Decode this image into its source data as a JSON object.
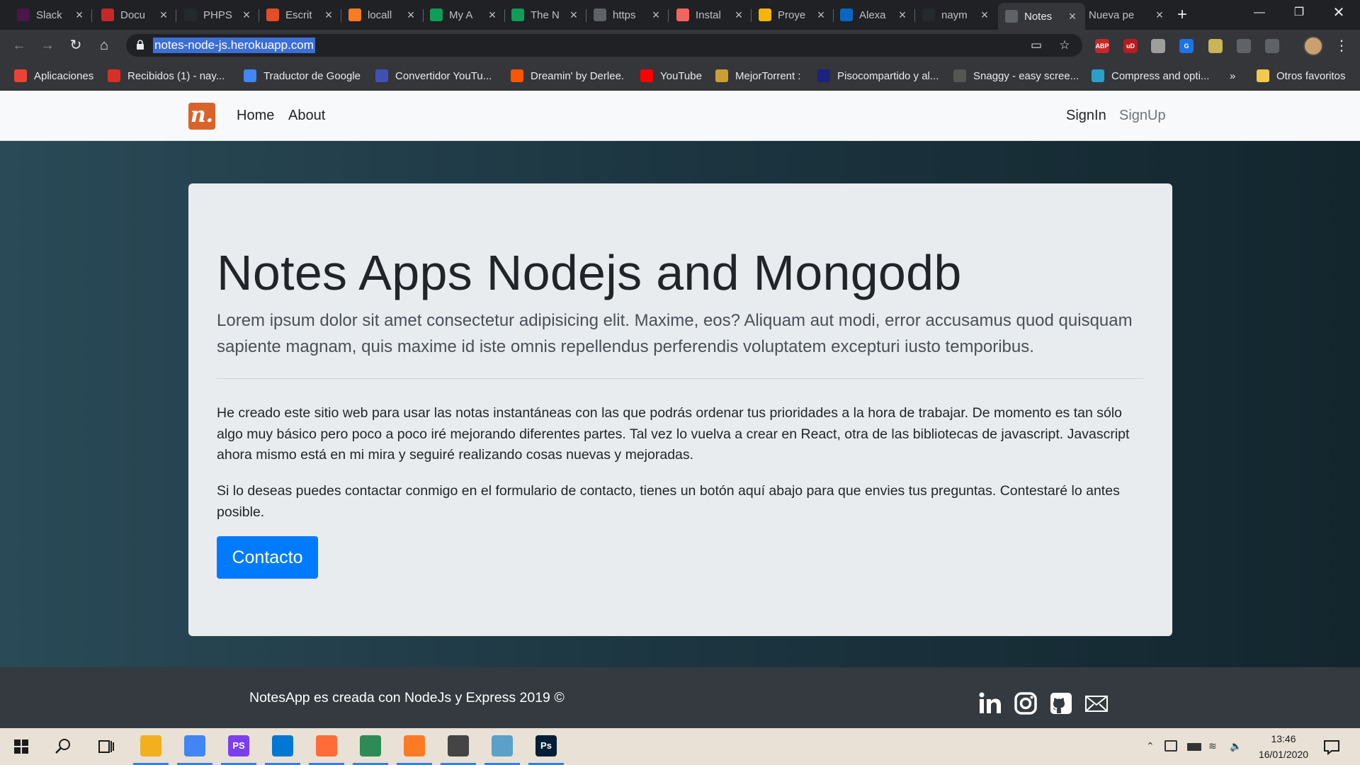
{
  "browser": {
    "tabs": [
      {
        "label": "Slack",
        "icon": "slack-icon",
        "color": "#4a154b"
      },
      {
        "label": "Docu",
        "icon": "pdf-icon",
        "color": "#c62828"
      },
      {
        "label": "PHPS",
        "icon": "github-icon",
        "color": "#24292e"
      },
      {
        "label": "Escrit",
        "icon": "html5-icon",
        "color": "#e44d26"
      },
      {
        "label": "locall",
        "icon": "xampp-icon",
        "color": "#fb7a24"
      },
      {
        "label": "My A",
        "icon": "sheets-icon",
        "color": "#0f9d58"
      },
      {
        "label": "The N",
        "icon": "sheets-icon",
        "color": "#0f9d58"
      },
      {
        "label": "https",
        "icon": "globe-icon",
        "color": "#5f6368"
      },
      {
        "label": "Instal",
        "icon": "laravel-icon",
        "color": "#f4645f"
      },
      {
        "label": "Proye",
        "icon": "slides-icon",
        "color": "#f4b400"
      },
      {
        "label": "Alexa",
        "icon": "linkedin-icon",
        "color": "#0a66c2"
      },
      {
        "label": "naym",
        "icon": "github-icon",
        "color": "#24292e"
      },
      {
        "label": "Notes",
        "icon": "globe-icon",
        "color": "#5f6368"
      },
      {
        "label": "Nueva pe",
        "icon": "",
        "color": ""
      }
    ],
    "url": "notes-node-js.herokuapp.com",
    "extensions": [
      {
        "label": "ABP",
        "color": "#c62828"
      },
      {
        "label": "uD",
        "color": "#b71c1c"
      },
      {
        "label": "",
        "color": "#9e9e9e"
      },
      {
        "label": "G",
        "color": "#1a73e8"
      },
      {
        "label": "",
        "color": "#c9b458"
      },
      {
        "label": "",
        "color": "#5f6368"
      },
      {
        "label": "",
        "color": "#5f6368"
      }
    ],
    "bookmarks": [
      {
        "label": "Aplicaciones",
        "icon": "apps-grid-icon",
        "color": "#ea4335"
      },
      {
        "label": "Recibidos (1) - nay...",
        "icon": "gmail-icon",
        "color": "#d93025"
      },
      {
        "label": "Traductor de Google",
        "icon": "translate-icon",
        "color": "#4285f4"
      },
      {
        "label": "Convertidor YouTu...",
        "icon": "converter-icon",
        "color": "#3f51b5"
      },
      {
        "label": "Dreamin' by Derlee.",
        "icon": "soundcloud-icon",
        "color": "#ff5500"
      },
      {
        "label": "YouTube",
        "icon": "youtube-icon",
        "color": "#ff0000"
      },
      {
        "label": "MejorTorrent :",
        "icon": "torrent-icon",
        "color": "#caa033"
      },
      {
        "label": "Pisocompartido y al...",
        "icon": "p-icon",
        "color": "#1a237e"
      },
      {
        "label": "Snaggy - easy scree...",
        "icon": "sg-icon",
        "color": "#555555"
      },
      {
        "label": "Compress and opti...",
        "icon": "compress-icon",
        "color": "#29a0c9"
      }
    ],
    "bookmarks_more": "»",
    "other_bookmarks": "Otros favoritos"
  },
  "site": {
    "logo_letter": "n.",
    "nav": {
      "home": "Home",
      "about": "About",
      "signin": "SignIn",
      "signup": "SignUp"
    },
    "title": "Notes Apps Nodejs and Mongodb",
    "lead": "Lorem ipsum dolor sit amet consectetur adipisicing elit. Maxime, eos? Aliquam aut modi, error accusamus quod quisquam sapiente magnam, quis maxime id iste omnis repellendus perferendis voluptatem excepturi iusto temporibus.",
    "paragraph1": "He creado este sitio web para usar las notas instantáneas con las que podrás ordenar tus prioridades a la hora de trabajar. De momento es tan sólo algo muy básico pero poco a poco iré mejorando diferentes partes. Tal vez lo vuelva a crear en React, otra de las bibliotecas de javascript. Javascript ahora mismo está en mi mira y seguiré realizando cosas nuevas y mejoradas.",
    "paragraph2": "Si lo deseas puedes contactar conmigo en el formulario de contacto, tienes un botón aquí abajo para que envies tus preguntas. Contestaré lo antes posible.",
    "contact_button": "Contacto",
    "footer_text": "NotesApp es creada con NodeJs y Express 2019 ©",
    "social": [
      "linkedin-icon",
      "instagram-icon",
      "github-icon",
      "mail-icon"
    ]
  },
  "taskbar": {
    "apps": [
      {
        "name": "file-explorer-icon",
        "color": "#f2b01e",
        "label": ""
      },
      {
        "name": "chrome-icon",
        "color": "#4285f4",
        "label": ""
      },
      {
        "name": "phpstorm-icon",
        "color": "#7b3ff2",
        "label": "PS"
      },
      {
        "name": "vscode-icon",
        "color": "#0078d4",
        "label": ""
      },
      {
        "name": "postman-icon",
        "color": "#ff6c37",
        "label": ""
      },
      {
        "name": "git-kraken-icon",
        "color": "#2e8b57",
        "label": ""
      },
      {
        "name": "xampp-icon",
        "color": "#fb7a24",
        "label": ""
      },
      {
        "name": "editor-icon",
        "color": "#444444",
        "label": ""
      },
      {
        "name": "notepad-icon",
        "color": "#5aa0c8",
        "label": ""
      },
      {
        "name": "photoshop-icon",
        "color": "#001e36",
        "label": "Ps"
      }
    ],
    "time": "13:46",
    "date": "16/01/2020"
  }
}
